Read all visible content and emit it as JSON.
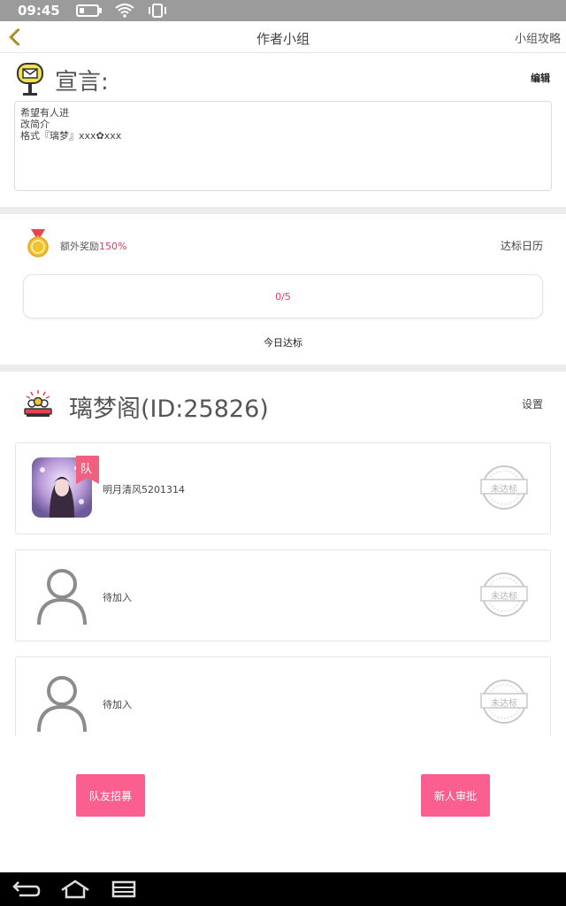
{
  "status_bar": {
    "time": "09:45"
  },
  "header": {
    "title": "作者小组",
    "guide_label": "小组攻略"
  },
  "manifesto": {
    "heading": "宣言:",
    "edit_label": "编辑",
    "lines": [
      "希望有人进",
      "改简介",
      "格式『璃梦』xxx✿xxx"
    ]
  },
  "reward": {
    "bonus_label": "额外奖励",
    "bonus_value": "150%",
    "calendar_label": "达标日历",
    "progress_text": "0/5",
    "progress_fraction": 0,
    "today_label": "今日达标"
  },
  "group": {
    "name": "璃梦阁(ID:25826)",
    "settings_label": "设置",
    "members": [
      {
        "name": "明月清风5201314",
        "captain_badge": "队",
        "stamp": "未达标"
      },
      {
        "name": "待加入",
        "stamp": "未达标"
      },
      {
        "name": "待加入",
        "stamp": "未达标"
      }
    ]
  },
  "actions": {
    "recruit_label": "队友招募",
    "approve_label": "新人审批"
  },
  "colors": {
    "accent": "#fb5f8f",
    "highlight_text": "#e23c5a",
    "status_bar": "#9b9b9b"
  }
}
